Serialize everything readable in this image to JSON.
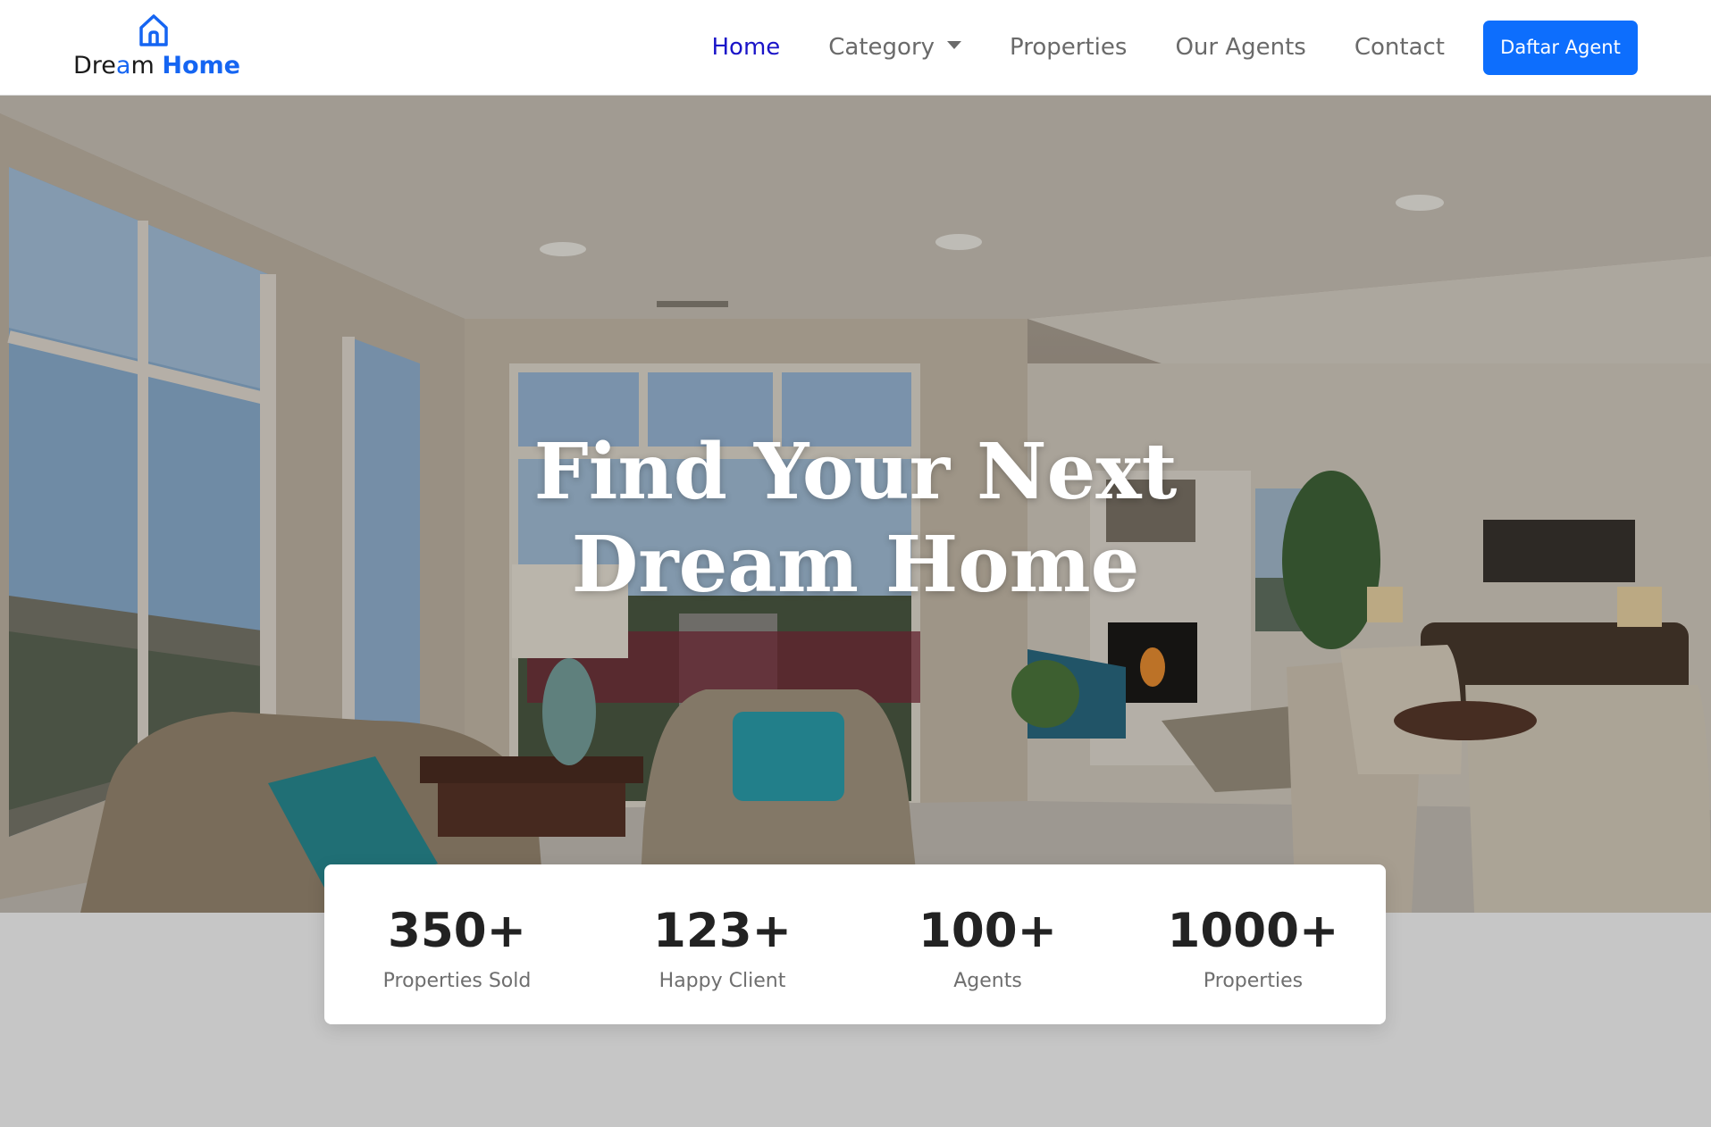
{
  "brand": {
    "name_part1": "Dre",
    "name_accent": "a",
    "name_part2": "m",
    "name_bold": "Home",
    "icon": "house-icon",
    "accent_color": "#1565f2"
  },
  "nav": {
    "items": [
      {
        "label": "Home",
        "active": true
      },
      {
        "label": "Category",
        "dropdown": true,
        "icon": "caret-down-icon"
      },
      {
        "label": "Properties"
      },
      {
        "label": "Our Agents"
      },
      {
        "label": "Contact"
      }
    ],
    "cta_label": "Daftar Agent",
    "active_color": "#1a14c8",
    "cta_color": "#0d6efd"
  },
  "hero": {
    "title_line1": "Find Your Next",
    "title_line2": "Dream Home"
  },
  "stats": [
    {
      "value": "350+",
      "label": "Properties Sold"
    },
    {
      "value": "123+",
      "label": "Happy Client"
    },
    {
      "value": "100+",
      "label": "Agents"
    },
    {
      "value": "1000+",
      "label": "Properties"
    }
  ]
}
